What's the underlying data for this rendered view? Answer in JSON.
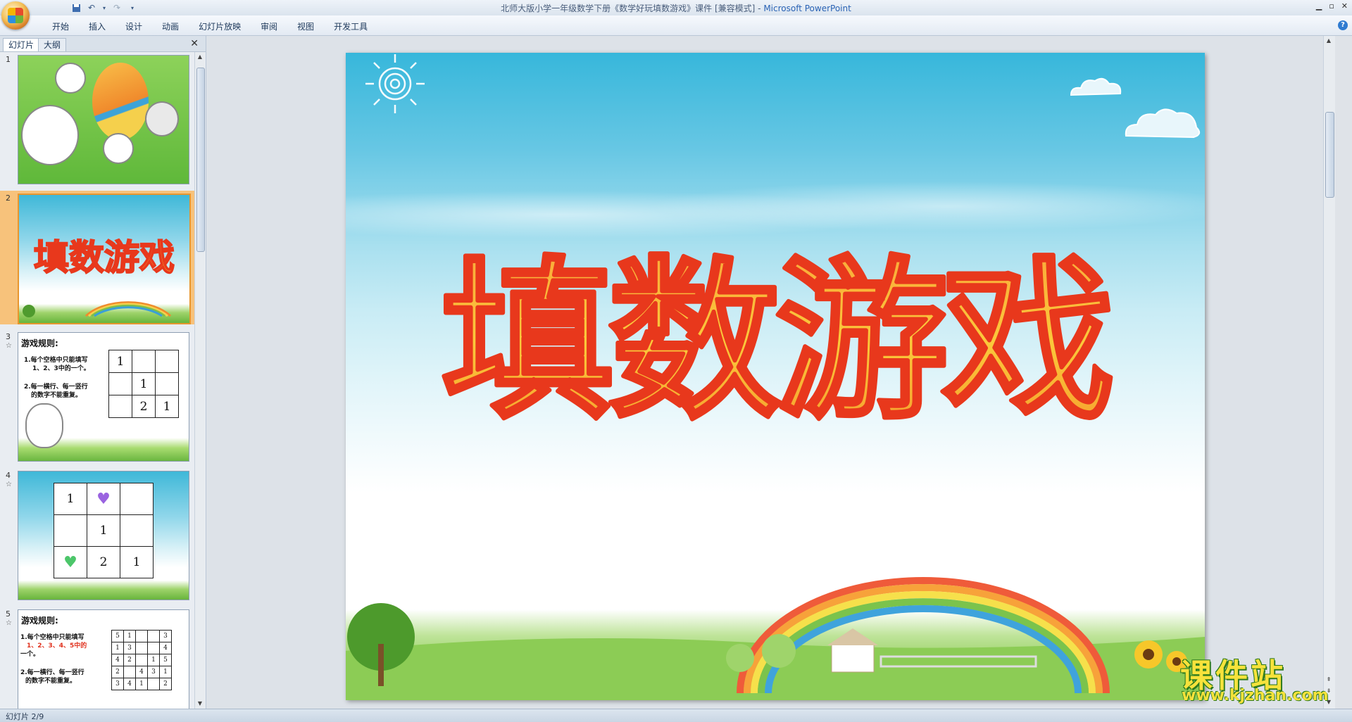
{
  "window": {
    "title": "北师大版小学一年级数学下册《数学好玩填数游戏》课件 [兼容模式] - ",
    "app_name": "Microsoft PowerPoint"
  },
  "qat": {
    "save_icon": "save-icon",
    "undo_icon": "undo-icon",
    "redo_icon": "redo-icon"
  },
  "ribbon": {
    "tabs": [
      "开始",
      "插入",
      "设计",
      "动画",
      "幻灯片放映",
      "审阅",
      "视图",
      "开发工具"
    ],
    "help": "?"
  },
  "left_pane": {
    "tab_slides": "幻灯片",
    "tab_outline": "大纲",
    "close": "✕",
    "thumbs": [
      {
        "num": "1"
      },
      {
        "num": "2",
        "title": "填数游戏"
      },
      {
        "num": "3",
        "rule_title": "游戏规则:",
        "rule1a": "1.每个空格中只能填写",
        "rule1b": "1、2、3中的一个。",
        "rule2a": "2.每一横行、每一竖行",
        "rule2b": "的数字不能重复。",
        "grid": [
          [
            "1",
            "",
            ""
          ],
          [
            "",
            "1",
            ""
          ],
          [
            "",
            "2",
            "1"
          ]
        ]
      },
      {
        "num": "4",
        "grid": [
          [
            "1",
            "♥",
            ""
          ],
          [
            "",
            "1",
            ""
          ],
          [
            "♥",
            "2",
            "1"
          ]
        ]
      },
      {
        "num": "5",
        "rule_title": "游戏规则:",
        "rule1a": "1.每个空格中只能填写",
        "rule1b": "1、2、3、4、5中的",
        "rule1c": "一个。",
        "rule2a": "2.每一横行、每一竖行",
        "rule2b": "的数字不能重复。",
        "grid": [
          [
            "5",
            "1",
            "",
            "",
            "3"
          ],
          [
            "1",
            "3",
            "",
            "",
            "4"
          ],
          [
            "4",
            "2",
            "",
            "1",
            "5"
          ],
          [
            "2",
            "",
            "4",
            "3",
            "1"
          ],
          [
            "3",
            "4",
            "1",
            "",
            "2"
          ]
        ]
      }
    ]
  },
  "slide": {
    "title": "填数游戏"
  },
  "watermark": {
    "title": "课件站",
    "url": "www.kjzhan.com"
  },
  "status": {
    "text": "幻灯片 2/9"
  },
  "colors": {
    "title_fill": "#f7a12d",
    "title_stroke": "#e8381c",
    "selected_thumb": "#f7c27b"
  }
}
